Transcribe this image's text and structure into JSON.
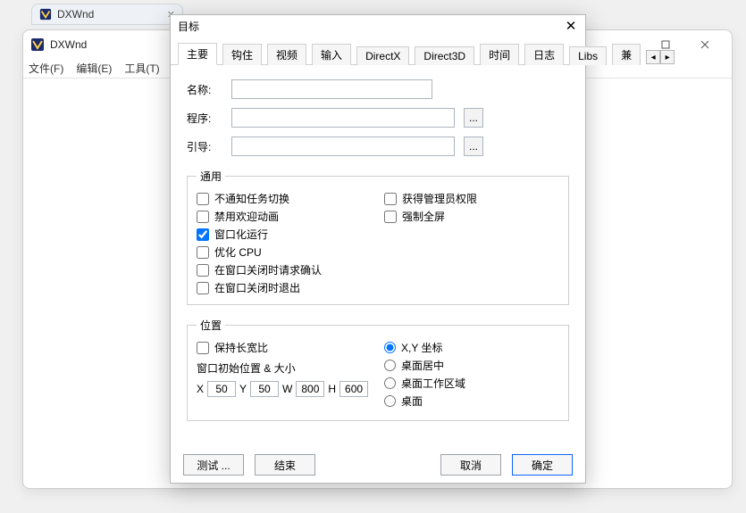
{
  "bg_tab": {
    "title": "DXWnd"
  },
  "main_window": {
    "title": "DXWnd",
    "menu": {
      "file": "文件(F)",
      "edit": "编辑(E)",
      "tools": "工具(T)",
      "more_indicator": ">"
    }
  },
  "dialog": {
    "title": "目标",
    "tabs": [
      {
        "label": "主要",
        "active": true
      },
      {
        "label": "钩住"
      },
      {
        "label": "视频"
      },
      {
        "label": "输入"
      },
      {
        "label": "DirectX"
      },
      {
        "label": "Direct3D"
      },
      {
        "label": "时间"
      },
      {
        "label": "日志"
      },
      {
        "label": "Libs"
      },
      {
        "label": "兼"
      }
    ],
    "fields": {
      "name_label": "名称:",
      "name_value": "",
      "program_label": "程序:",
      "program_value": "",
      "program_browse": "...",
      "guide_label": "引导:",
      "guide_value": "",
      "guide_browse": "..."
    },
    "group_general": {
      "legend": "通用",
      "items": {
        "no_notify_task_switch": {
          "label": "不通知任务切换",
          "checked": false
        },
        "acquire_admin": {
          "label": "获得管理员权限",
          "checked": false
        },
        "disable_welcome_anim": {
          "label": "禁用欢迎动画",
          "checked": false
        },
        "force_fullscreen": {
          "label": "强制全屏",
          "checked": false
        },
        "windowed_run": {
          "label": "窗口化运行",
          "checked": true
        },
        "optimize_cpu": {
          "label": "优化 CPU",
          "checked": false
        },
        "confirm_on_close": {
          "label": "在窗口关闭时请求确认",
          "checked": false
        },
        "exit_on_close": {
          "label": "在窗口关闭时退出",
          "checked": false
        }
      }
    },
    "group_position": {
      "legend": "位置",
      "keep_aspect": {
        "label": "保持长宽比",
        "checked": false
      },
      "size_label": "窗口初始位置 & 大小",
      "coords": {
        "x_label": "X",
        "x": "50",
        "y_label": "Y",
        "y": "50",
        "w_label": "W",
        "w": "800",
        "h_label": "H",
        "h": "600"
      },
      "placement": {
        "selected": "xy",
        "options": {
          "xy": "X,Y 坐标",
          "center": "桌面居中",
          "workarea": "桌面工作区域",
          "desktop": "桌面"
        }
      }
    },
    "buttons": {
      "test": "测试 ...",
      "finish": "结束",
      "cancel": "取消",
      "ok": "确定"
    }
  }
}
